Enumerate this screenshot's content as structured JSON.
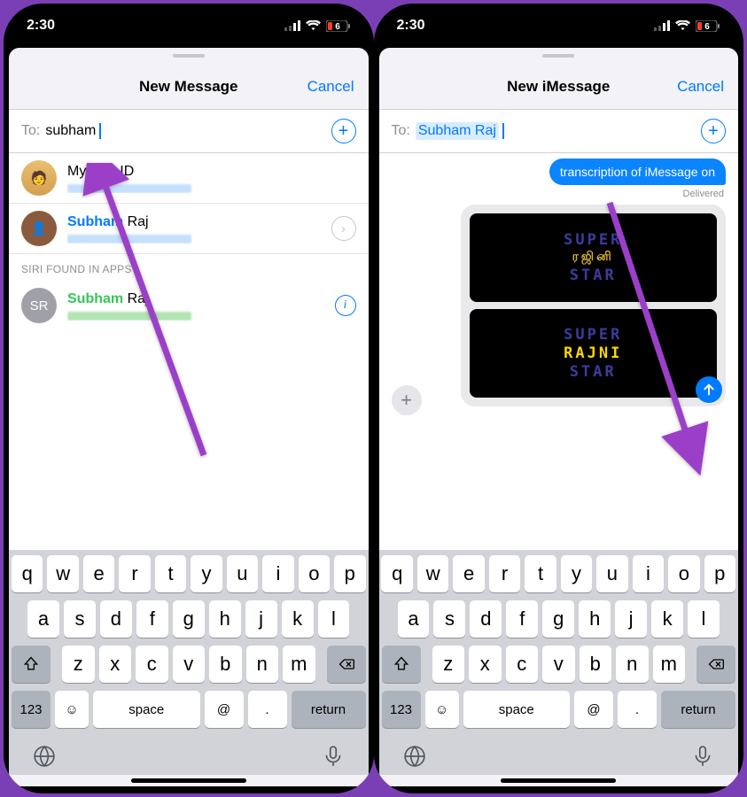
{
  "status": {
    "time": "2:30",
    "battery": "6"
  },
  "left": {
    "title": "New Message",
    "cancel": "Cancel",
    "to_label": "To:",
    "to_value": "subham",
    "contacts": [
      {
        "name": "My Test ID",
        "avatar": "av1"
      },
      {
        "name_hl": "Subham",
        "name_rest": " Raj",
        "avatar": "av2",
        "chevron": true
      }
    ],
    "section": "SIRI FOUND IN APPS",
    "siri": {
      "name_hl": "Subham",
      "name_rest": " Raj",
      "initials": "SR"
    }
  },
  "right": {
    "title": "New iMessage",
    "cancel": "Cancel",
    "to_label": "To:",
    "to_chip": "Subham Raj",
    "bubble": "transcription of iMessage on",
    "delivered": "Delivered",
    "thumb": {
      "l1": "SUPER",
      "ly": "ரஜினி",
      "l3": "STAR"
    },
    "thumb2": {
      "l1": "SUPER",
      "ly": "RAJNI",
      "l3": "STAR"
    }
  },
  "kb": {
    "r1": [
      "q",
      "w",
      "e",
      "r",
      "t",
      "y",
      "u",
      "i",
      "o",
      "p"
    ],
    "r2": [
      "a",
      "s",
      "d",
      "f",
      "g",
      "h",
      "j",
      "k",
      "l"
    ],
    "r3": [
      "z",
      "x",
      "c",
      "v",
      "b",
      "n",
      "m"
    ],
    "k123": "123",
    "space": "space",
    "at": "@",
    "dot": ".",
    "ret": "return"
  }
}
